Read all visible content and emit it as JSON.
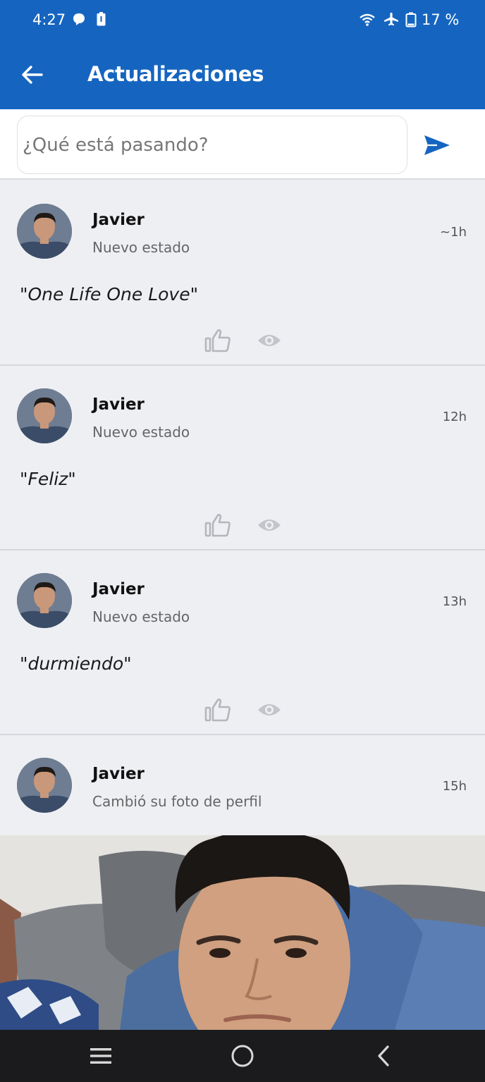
{
  "status_bar": {
    "time": "4:27",
    "battery_percent": "17 %"
  },
  "app_bar": {
    "title": "Actualizaciones"
  },
  "composer": {
    "placeholder": "¿Qué está pasando?"
  },
  "feed": [
    {
      "author": "Javier",
      "subtitle": "Nuevo estado",
      "time_ago": "~1h",
      "status_text": "\"One Life One Love\""
    },
    {
      "author": "Javier",
      "subtitle": "Nuevo estado",
      "time_ago": "12h",
      "status_text": "\"Feliz\""
    },
    {
      "author": "Javier",
      "subtitle": "Nuevo estado",
      "time_ago": "13h",
      "status_text": "\"durmiendo\""
    },
    {
      "author": "Javier",
      "subtitle": "Cambió su foto de perfil",
      "time_ago": "15h"
    }
  ],
  "colors": {
    "primary": "#1565c0",
    "background": "#eeeff3",
    "action_icon": "#b4b6bb"
  },
  "icons": [
    "back-arrow-icon",
    "send-icon",
    "thumbs-up-icon",
    "eye-icon",
    "menu-icon",
    "home-circle-icon",
    "back-chevron-icon",
    "wifi-icon",
    "airplane-icon",
    "battery-icon",
    "notification-icon"
  ]
}
